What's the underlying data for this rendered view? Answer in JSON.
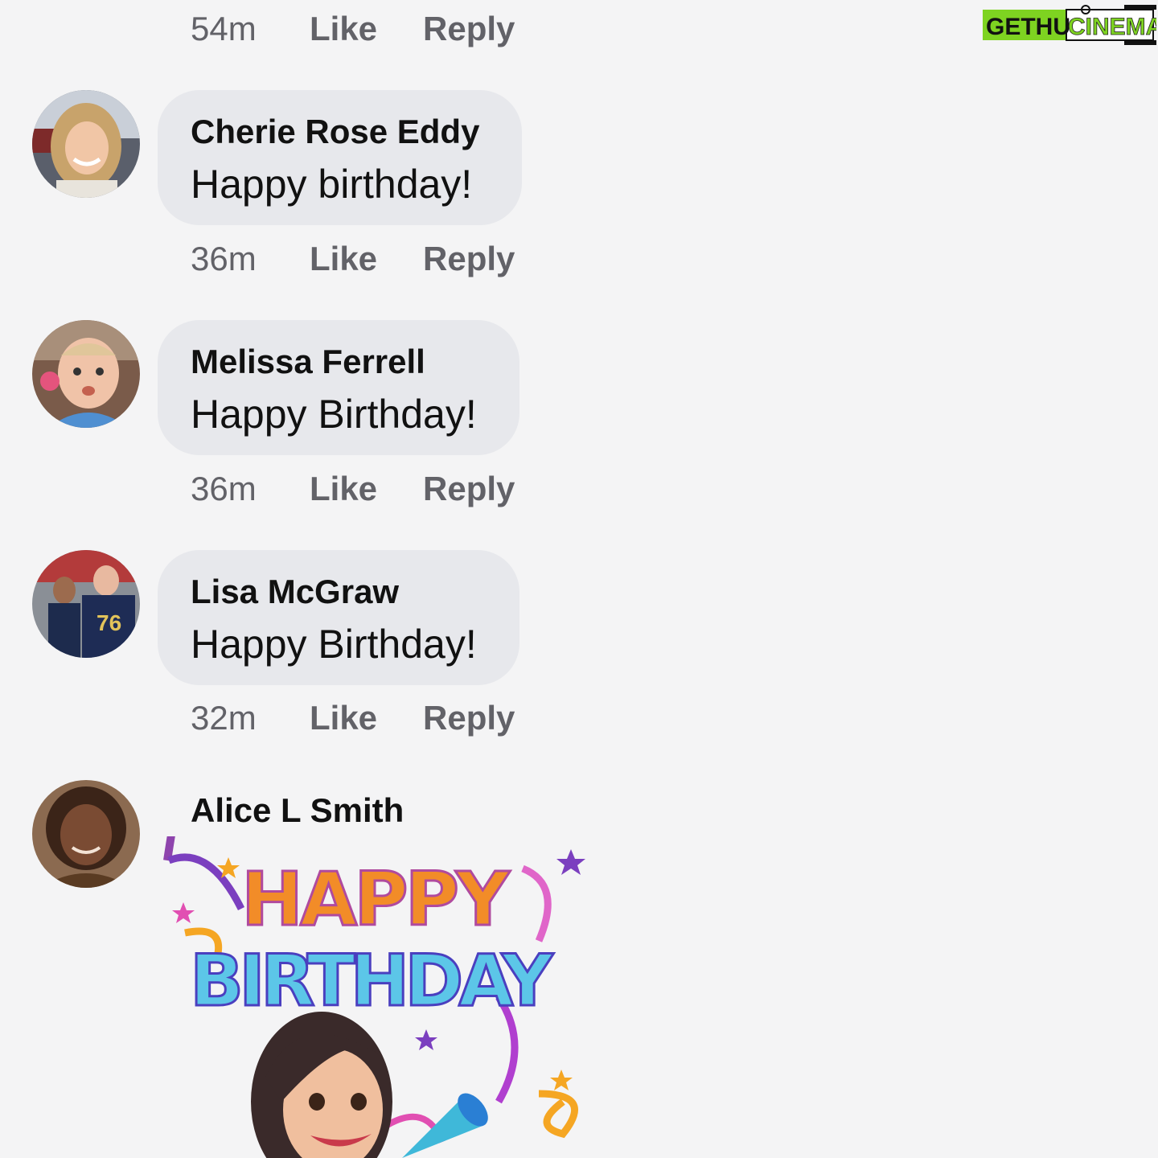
{
  "watermark": {
    "text_left": "GETHU",
    "text_right": "CINEMA"
  },
  "top_actions": {
    "time": "54m",
    "like": "Like",
    "reply": "Reply"
  },
  "comments": [
    {
      "name": "Cherie Rose Eddy",
      "text": "Happy birthday!",
      "time": "36m",
      "like": "Like",
      "reply": "Reply"
    },
    {
      "name": "Melissa Ferrell",
      "text": "Happy Birthday!",
      "time": "36m",
      "like": "Like",
      "reply": "Reply"
    },
    {
      "name": "Lisa McGraw",
      "text": "Happy Birthday!",
      "time": "32m",
      "like": "Like",
      "reply": "Reply"
    }
  ],
  "sticker_comment": {
    "name": "Alice L Smith",
    "sticker_line1": "HAPPY",
    "sticker_line2": "BIRTHDAY"
  },
  "colors": {
    "background": "#f4f4f5",
    "bubble": "#e7e8ec",
    "meta_text": "#626268",
    "watermark_green": "#7ed321"
  }
}
